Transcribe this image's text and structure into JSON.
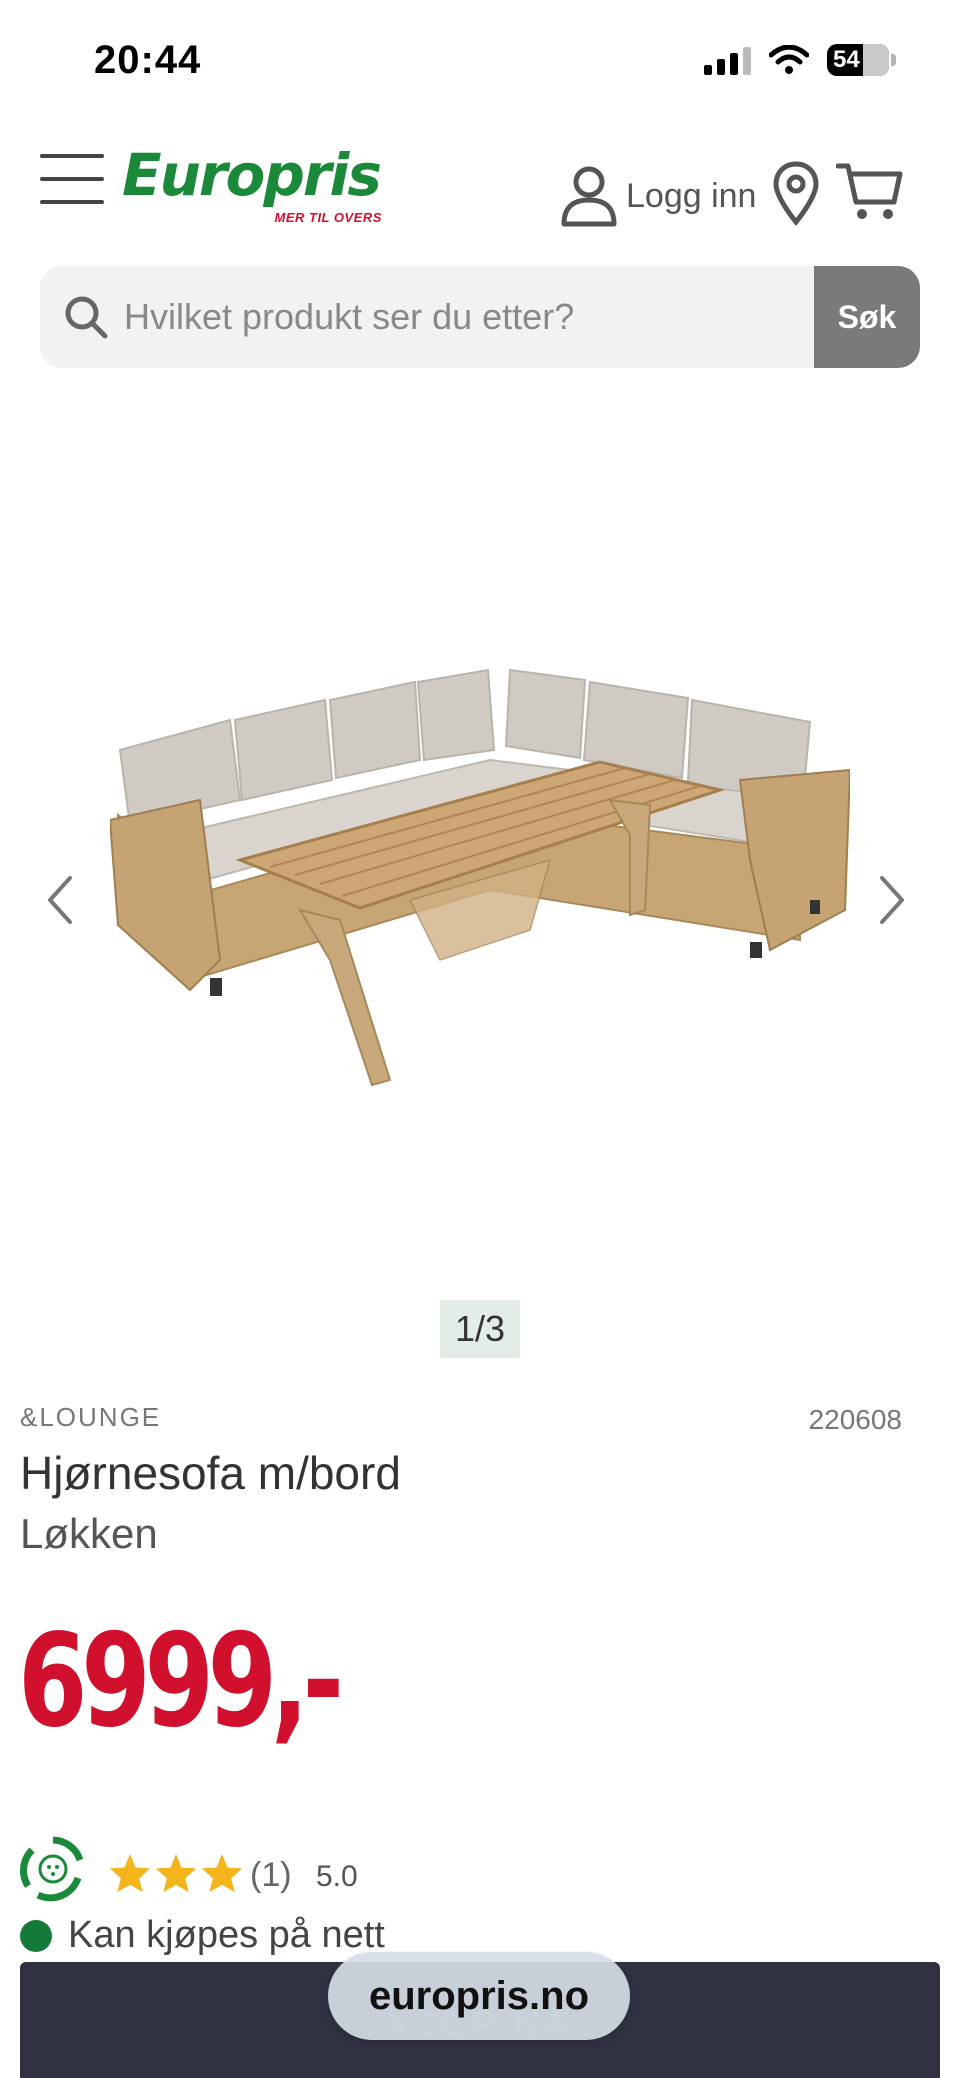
{
  "status_bar": {
    "time": "20:44",
    "battery": "54"
  },
  "header": {
    "logo_text": "Europris",
    "logo_tagline": "MER TIL OVERS",
    "login_label": "Logg inn",
    "brand_green": "#1a8a3a",
    "brand_red": "#d1102e"
  },
  "search": {
    "placeholder": "Hvilket produkt ser du etter?",
    "button_label": "Søk"
  },
  "gallery": {
    "counter": "1/3"
  },
  "product": {
    "brand": "&LOUNGE",
    "sku": "220608",
    "title": "Hjørnesofa m/bord",
    "subtitle": "Løkken",
    "price": "6999,-",
    "rating_stars": 3,
    "rating_count": "(1)",
    "rating_score": "5.0",
    "availability": "Kan kjøpes på nett"
  },
  "cta": {
    "ghost_label": "KJØP NÅ"
  },
  "browser": {
    "url": "europris.no"
  }
}
